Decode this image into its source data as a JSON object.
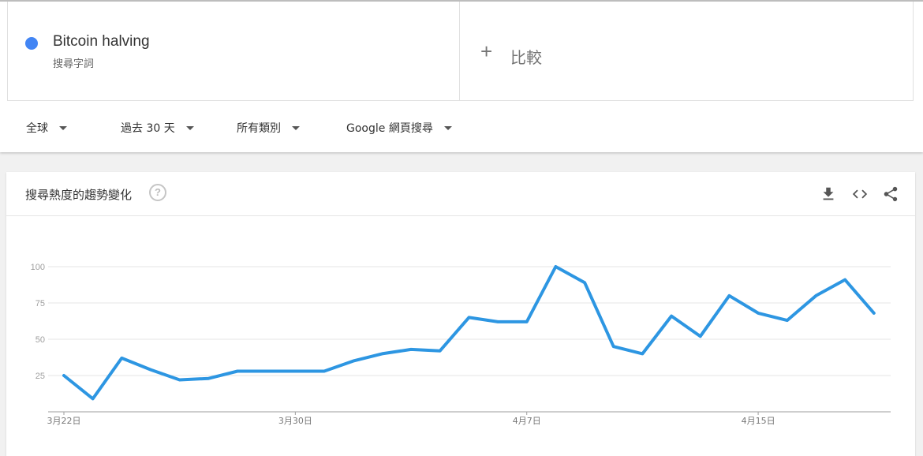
{
  "search_term": {
    "name": "Bitcoin halving",
    "type_label": "搜尋字詞",
    "dot_color": "#4285f4"
  },
  "compare": {
    "plus": "+",
    "label": "比較"
  },
  "filters": [
    {
      "label": "全球"
    },
    {
      "label": "過去 30 天"
    },
    {
      "label": "所有類別"
    },
    {
      "label": "Google 網頁搜尋"
    }
  ],
  "chart_section": {
    "title": "搜尋熱度的趨勢變化",
    "help": "?",
    "icons": [
      "download-icon",
      "embed-code-icon",
      "share-icon"
    ]
  },
  "chart_data": {
    "type": "line",
    "x": [
      "3月22日",
      "3月23日",
      "3月24日",
      "3月25日",
      "3月26日",
      "3月27日",
      "3月28日",
      "3月29日",
      "3月30日",
      "3月31日",
      "4月1日",
      "4月2日",
      "4月3日",
      "4月4日",
      "4月5日",
      "4月6日",
      "4月7日",
      "4月8日",
      "4月9日",
      "4月10日",
      "4月11日",
      "4月12日",
      "4月13日",
      "4月14日",
      "4月15日",
      "4月16日",
      "4月17日",
      "4月18日",
      "4月19日",
      "4月20日"
    ],
    "x_tick_labels": [
      "3月22日",
      "3月30日",
      "4月7日",
      "4月15日"
    ],
    "x_tick_indices": [
      0,
      8,
      16,
      24
    ],
    "series": [
      {
        "color": "#2d96e2",
        "values": [
          25,
          9,
          37,
          29,
          22,
          23,
          28,
          28,
          28,
          28,
          35,
          40,
          43,
          42,
          65,
          62,
          62,
          100,
          89,
          45,
          40,
          66,
          52,
          80,
          68,
          63,
          80,
          91,
          68
        ]
      }
    ],
    "y_ticks": [
      25,
      50,
      75,
      100
    ],
    "ylim": [
      0,
      100
    ],
    "grid": true,
    "title": "搜尋熱度的趨勢變化"
  }
}
